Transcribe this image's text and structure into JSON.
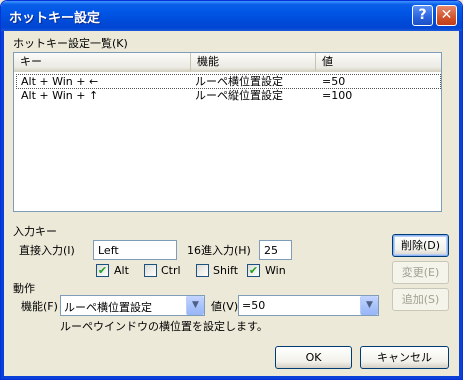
{
  "titlebar": {
    "title": "ホットキー設定",
    "help_glyph": "?",
    "close_glyph": "✕"
  },
  "list_label": "ホットキー設定一覧(K)",
  "list": {
    "columns": [
      "キー",
      "機能",
      "値"
    ],
    "rows": [
      {
        "key": "Alt + Win + ←",
        "function": "ルーペ横位置設定",
        "value": "=50"
      },
      {
        "key": "Alt + Win + ↑",
        "function": "ルーペ縦位置設定",
        "value": "=100"
      }
    ]
  },
  "input_key": {
    "section_label": "入力キー",
    "direct_label": "直接入力(I)",
    "direct_value": "Left",
    "hex_label": "16進入力(H)",
    "hex_value": "25",
    "modifiers": [
      {
        "label": "Alt",
        "checked": true
      },
      {
        "label": "Ctrl",
        "checked": false
      },
      {
        "label": "Shift",
        "checked": false
      },
      {
        "label": "Win",
        "checked": true
      }
    ],
    "check_glyph": "✔"
  },
  "action": {
    "section_label": "動作",
    "function_label": "機能(F)",
    "function_value": "ルーペ横位置設定",
    "value_label": "値(V)",
    "value_value": "=50",
    "description": "ルーペウインドウの横位置を設定します。",
    "dropdown_glyph": "▼"
  },
  "side_buttons": {
    "delete": "削除(D)",
    "change": "変更(E)",
    "add": "追加(S)"
  },
  "footer": {
    "ok": "OK",
    "cancel": "キャンセル"
  },
  "colors": {
    "titlebar": "#0055e5",
    "dialog_bg": "#ece9d8",
    "check_mark": "#21a121"
  }
}
